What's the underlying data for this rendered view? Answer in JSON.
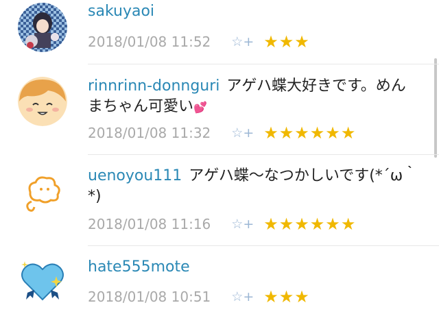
{
  "comments": [
    {
      "user": "sakuyaoi",
      "text": "",
      "date": "2018/01/08 11:52",
      "stars": "★★★"
    },
    {
      "user": "rinnrinn-donnguri",
      "text": "アゲハ蝶大好きです。めんまちゃん可愛い",
      "emoji": "💕",
      "date": "2018/01/08 11:32",
      "stars": "★★★★★★"
    },
    {
      "user": "uenoyou111",
      "text": "アゲハ蝶～なつかしいです(*´ω｀*)",
      "date": "2018/01/08 11:16",
      "stars": "★★★★★★"
    },
    {
      "user": "hate555mote",
      "text": "",
      "date": "2018/01/08 10:51",
      "stars": "★★★"
    }
  ],
  "ui": {
    "add_star_icon": "☆+"
  },
  "colors": {
    "username": "#2a88b5",
    "star": "#f0b800",
    "meta": "#a9a9a9",
    "divider": "#e7e7e7"
  }
}
